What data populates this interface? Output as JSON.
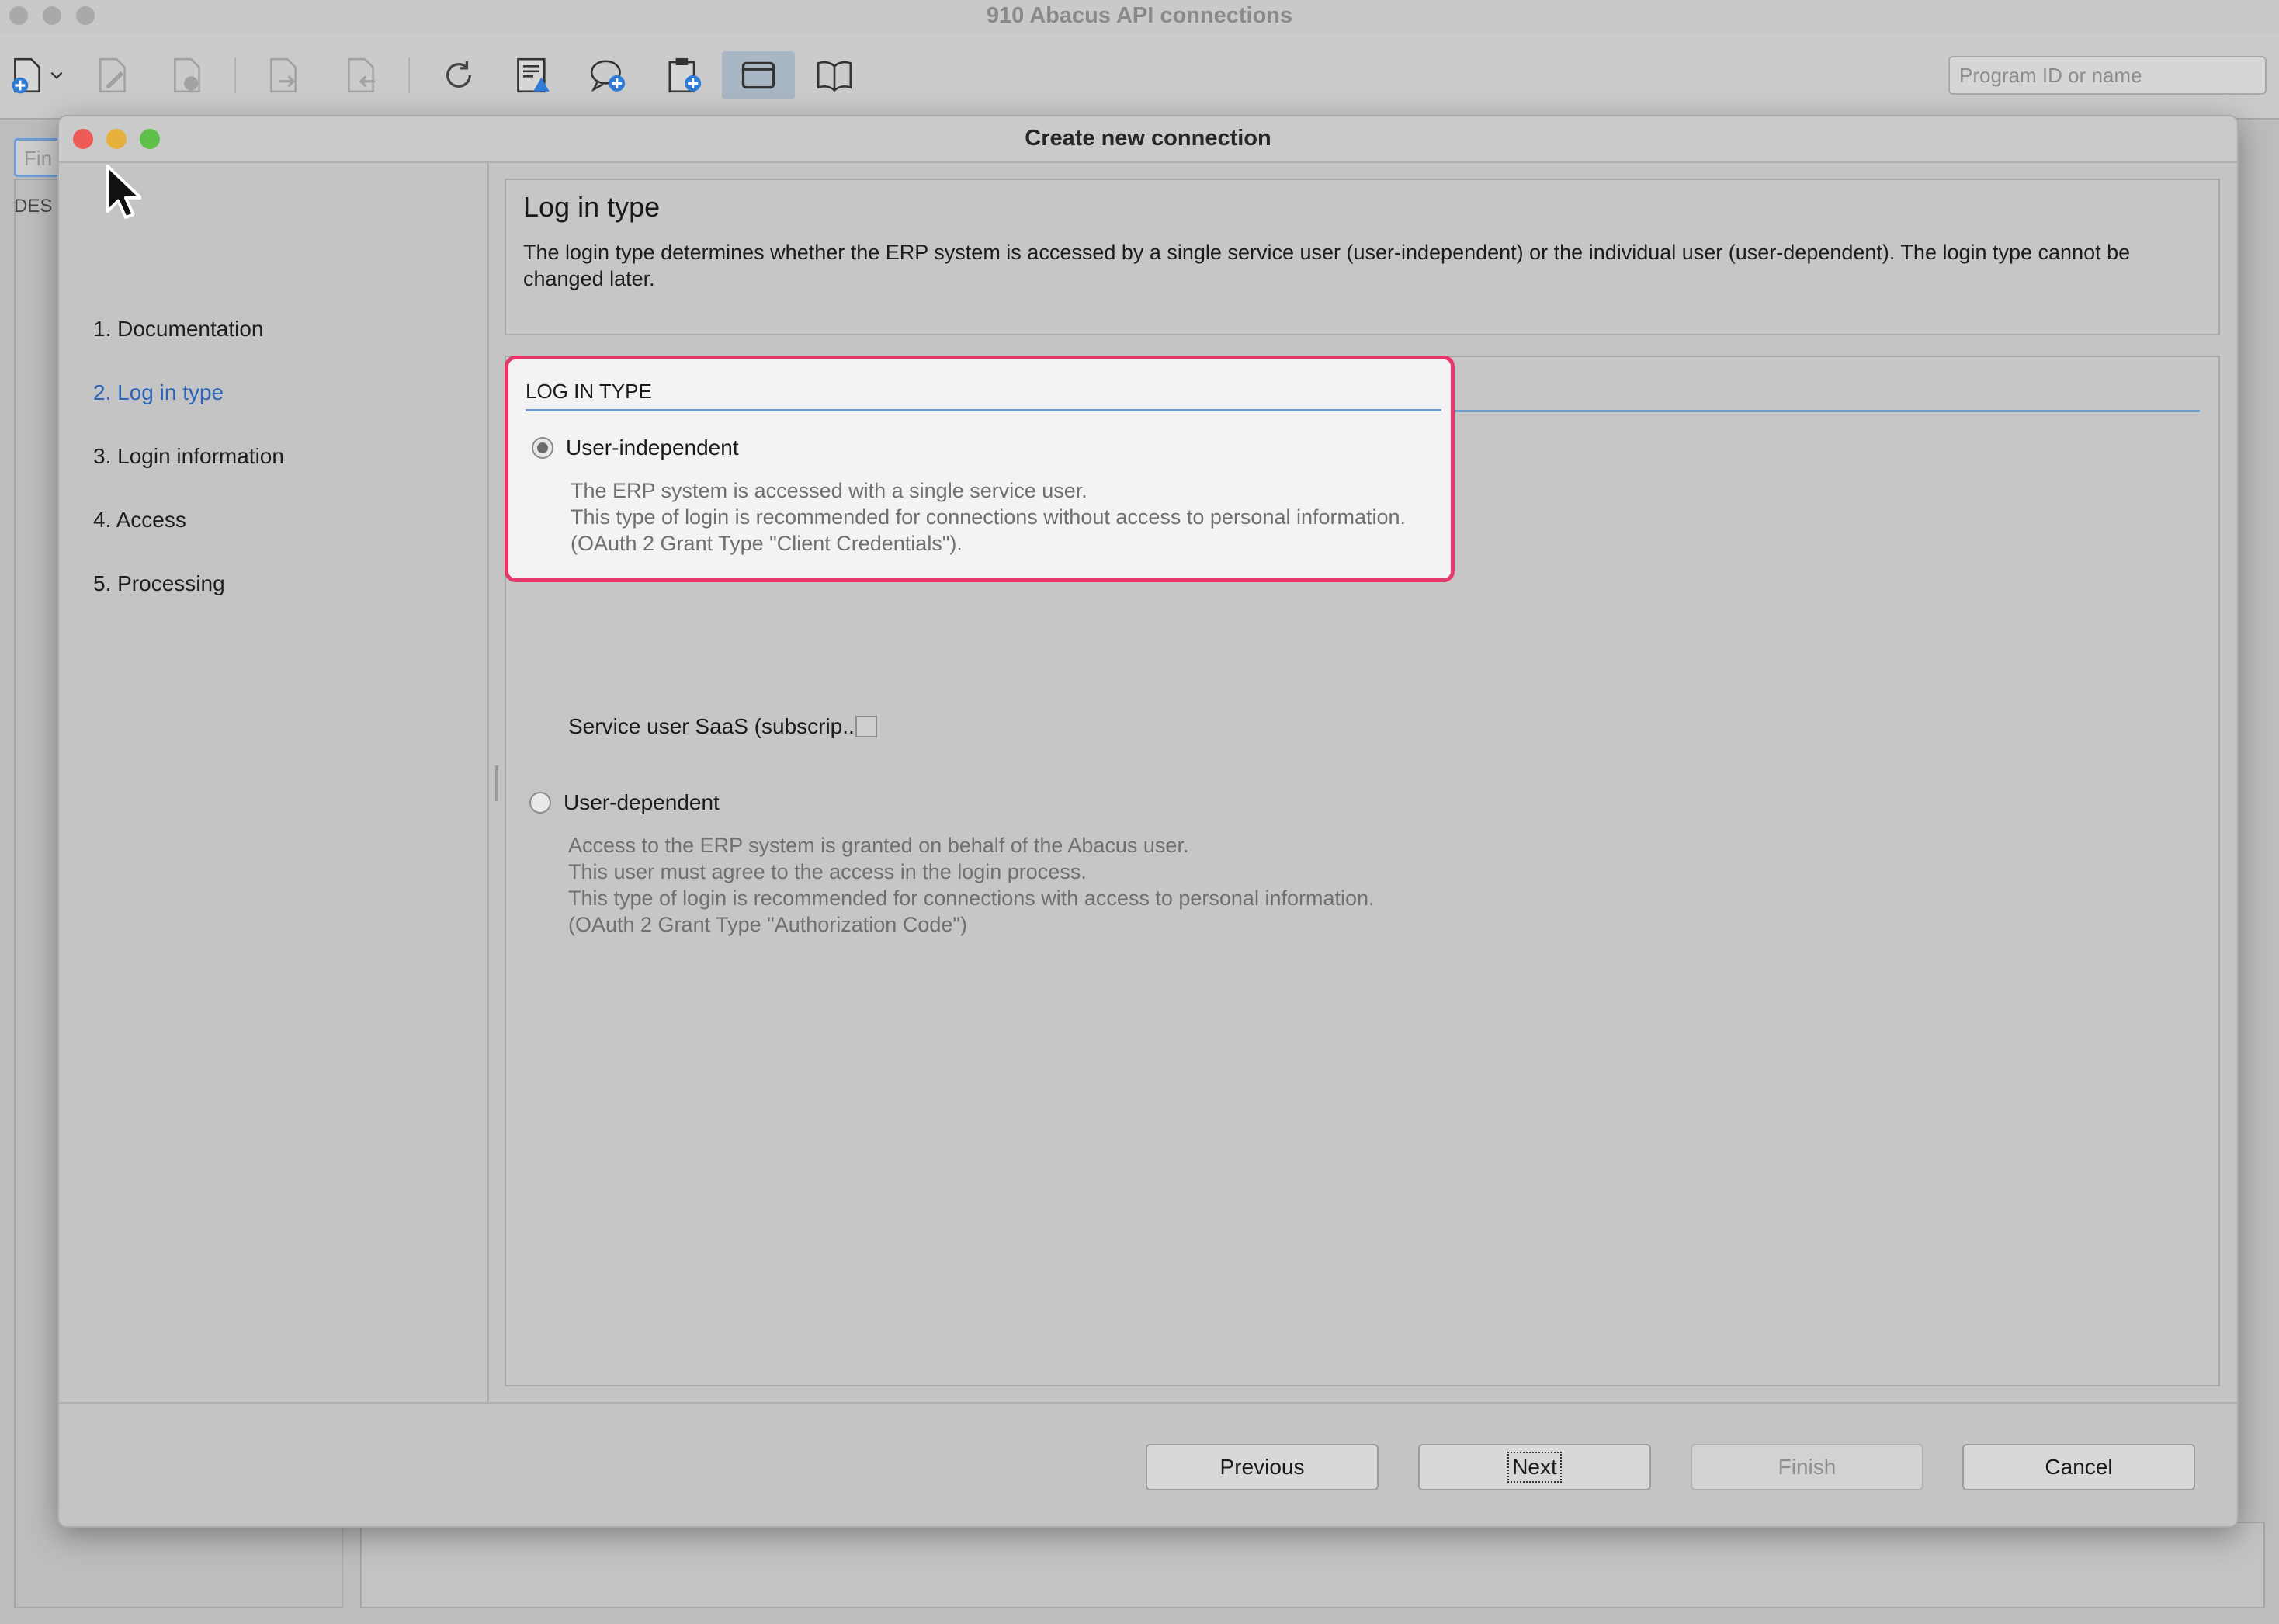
{
  "app": {
    "title": "910 Abacus API connections",
    "search_placeholder": "Program ID or name",
    "find_placeholder": "Fin",
    "left_column_header": "DES"
  },
  "toolbar": {
    "icons": [
      "new-document-icon",
      "dropdown-arrow-icon",
      "edit-document-icon",
      "delete-document-icon",
      "export-icon",
      "import-icon",
      "refresh-icon",
      "report-warning-icon",
      "comment-add-icon",
      "clipboard-add-icon",
      "window-icon",
      "book-icon"
    ]
  },
  "dialog": {
    "title": "Create new connection",
    "steps": [
      {
        "label": "1. Documentation",
        "current": false
      },
      {
        "label": "2. Log in type",
        "current": true
      },
      {
        "label": "3. Login information",
        "current": false
      },
      {
        "label": "4. Access",
        "current": false
      },
      {
        "label": "5. Processing",
        "current": false
      }
    ],
    "info": {
      "heading": "Log in type",
      "text": "The login type determines whether the ERP system is accessed by a single service user (user-independent) or the individual user (user-dependent). The login type cannot be changed later."
    },
    "section": {
      "label": "LOG IN TYPE",
      "options": [
        {
          "label": "User-independent",
          "selected": true,
          "description": [
            "The ERP system is accessed with a single service user.",
            "This type of login is recommended for connections without access to personal information.",
            "(OAuth 2 Grant Type \"Client Credentials\")."
          ]
        },
        {
          "label": "User-dependent",
          "selected": false,
          "description": [
            "Access to the ERP system is granted on behalf of the Abacus user.",
            "This user must agree to the access in the login process.",
            "This type of login is recommended for connections with access to personal information.",
            "(OAuth 2 Grant Type \"Authorization Code\")"
          ]
        }
      ],
      "saas_checkbox": {
        "label": "Service user SaaS (subscrip...",
        "checked": false
      }
    },
    "buttons": {
      "previous": "Previous",
      "next": "Next",
      "finish": "Finish",
      "cancel": "Cancel"
    }
  },
  "colors": {
    "highlight_border": "#e7376a",
    "current_step": "#2c63b6",
    "section_rule": "#6e9ac9"
  }
}
